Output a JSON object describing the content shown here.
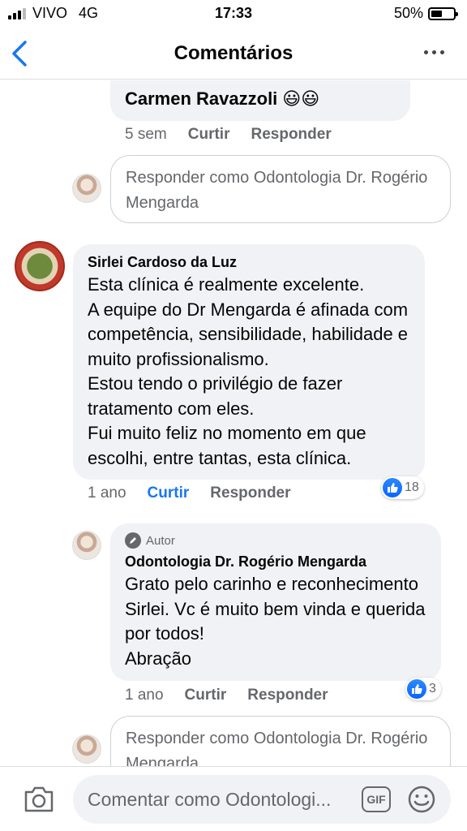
{
  "status_bar": {
    "carrier": "VIVO",
    "network": "4G",
    "time": "17:33",
    "battery_percent": "50%",
    "battery_level": 0.5
  },
  "header": {
    "title": "Comentários",
    "back_icon": "chevron-left-icon",
    "more_icon": "more-horizontal-icon"
  },
  "comment_carmen": {
    "name": "Carmen Ravazzoli",
    "emojis": "😃😃",
    "time": "5 sem",
    "like_label": "Curtir",
    "reply_label": "Responder"
  },
  "reply_prompt_1": {
    "placeholder": "Responder como Odontologia Dr. Rogério Mengarda"
  },
  "comment_sirlei": {
    "name": "Sirlei Cardoso da Luz",
    "text": "Esta clínica é realmente excelente.\nA equipe do Dr Mengarda é afinada com competência, sensibilidade, habilidade e muito profissionalismo.\nEstou tendo o privilégio de fazer tratamento com eles.\nFui muito feliz no momento em que escolhi, entre tantas,  esta clínica.",
    "time": "1 ano",
    "like_label": "Curtir",
    "reply_label": "Responder",
    "reaction_count": "18",
    "liked": true
  },
  "reply_odonto": {
    "badge": "Autor",
    "name": "Odontologia Dr. Rogério Mengarda",
    "text": "Grato pelo carinho e reconhecimento Sirlei. Vc é muito bem vinda e querida por todos!\nAbração",
    "time": "1 ano",
    "like_label": "Curtir",
    "reply_label": "Responder",
    "reaction_count": "3"
  },
  "reply_prompt_2": {
    "placeholder": "Responder como Odontologia Dr. Rogério Mengarda"
  },
  "bottom_bar": {
    "placeholder": "Comentar como Odontologi...",
    "gif_label": "GIF",
    "camera_icon": "camera-icon",
    "emoji_icon": "smile-icon"
  },
  "colors": {
    "accent": "#1877f2",
    "bubble": "#f0f2f5",
    "secondary_text": "#65676b"
  }
}
